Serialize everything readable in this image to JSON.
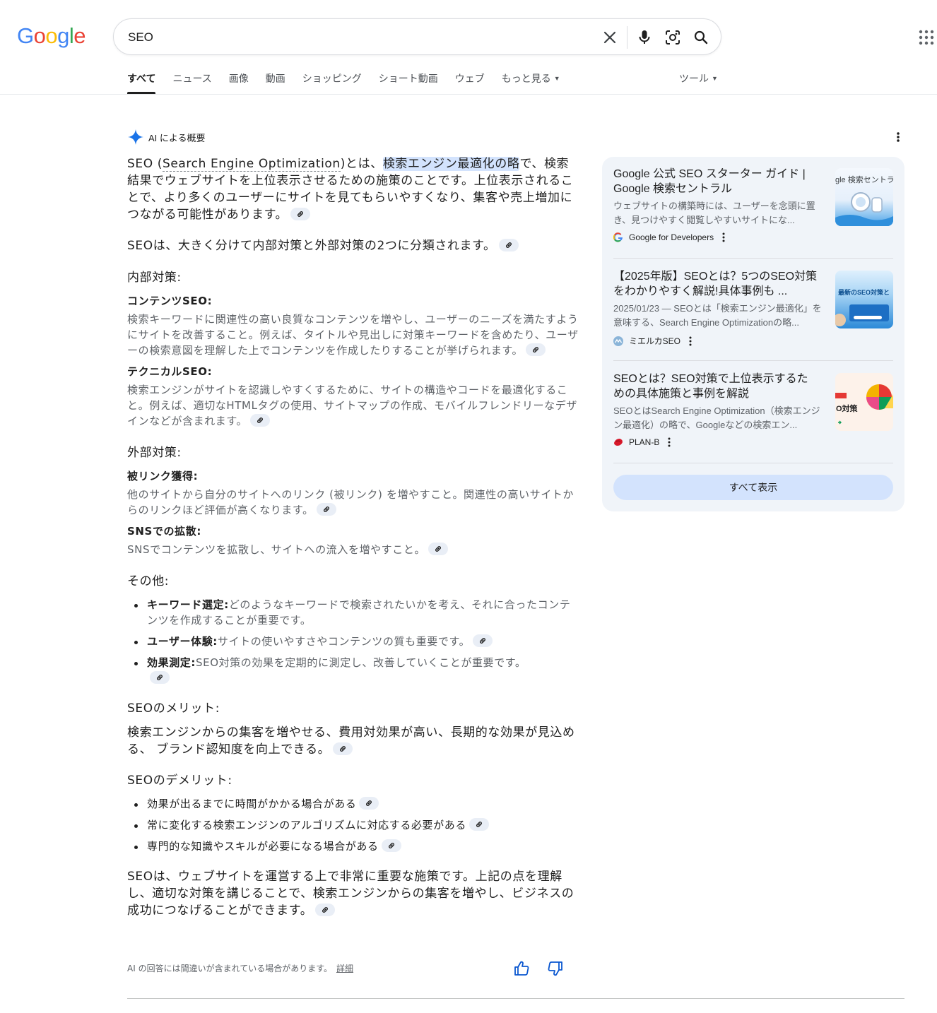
{
  "logo": {
    "letters": [
      "G",
      "o",
      "o",
      "g",
      "l",
      "e"
    ],
    "colors": [
      "#4285F4",
      "#EA4335",
      "#FBBC05",
      "#4285F4",
      "#34A853",
      "#EA4335"
    ]
  },
  "search": {
    "value": "SEO",
    "icons": [
      "close-icon",
      "mic-icon",
      "lens-icon",
      "search-icon"
    ]
  },
  "tabs": {
    "all": "すべて",
    "news": "ニュース",
    "images": "画像",
    "videos": "動画",
    "shopping": "ショッピング",
    "short_videos": "ショート動画",
    "web": "ウェブ",
    "more": "もっと見る",
    "tools": "ツール"
  },
  "ai_overview": {
    "header": "AI による概要",
    "intro_a": "SEO (",
    "intro_term": "Search Engine Optimization",
    "intro_b": ")とは、",
    "intro_hl": "検索エンジン最適化の略",
    "intro_c": "で、検索結果でウェブサイトを上位表示させるための施策のことです。上位表示されることで、より多くのユーザーにサイトを見てもらいやすくなり、集客や売上増加につながる可能性があります。",
    "classify": "SEOは、大きく分けて内部対策と外部対策の2つに分類されます。",
    "internal_heading": "内部対策:",
    "content_seo_heading": "コンテンツSEO:",
    "content_seo_text": "検索キーワードに関連性の高い良質なコンテンツを増やし、ユーザーのニーズを満たすようにサイトを改善すること。例えば、タイトルや見出しに対策キーワードを含めたり、ユーザーの検索意図を理解した上でコンテンツを作成したりすることが挙げられます。",
    "technical_seo_heading": "テクニカルSEO:",
    "technical_seo_text": "検索エンジンがサイトを認識しやすくするために、サイトの構造やコードを最適化すること。例えば、適切なHTMLタグの使用、サイトマップの作成、モバイルフレンドリーなデザインなどが含まれます。",
    "external_heading": "外部対策:",
    "backlink_heading": "被リンク獲得:",
    "backlink_text": "他のサイトから自分のサイトへのリンク (被リンク) を増やすこと。関連性の高いサイトからのリンクほど評価が高くなります。",
    "sns_heading": "SNSでの拡散:",
    "sns_text": "SNSでコンテンツを拡散し、サイトへの流入を増やすこと。",
    "other_heading": "その他:",
    "other_items": [
      {
        "bold": "キーワード選定:",
        "text": "どのようなキーワードで検索されたいかを考え、それに合ったコンテンツを作成することが重要です。"
      },
      {
        "bold": "ユーザー体験:",
        "text": "サイトの使いやすさやコンテンツの質も重要です。"
      },
      {
        "bold": "効果測定:",
        "text": "SEO対策の効果を定期的に測定し、改善していくことが重要です。"
      }
    ],
    "merit_heading": "SEOのメリット:",
    "merit_text": "検索エンジンからの集客を増やせる、費用対効果が高い、長期的な効果が見込める、 ブランド認知度を向上できる。",
    "demerit_heading": "SEOのデメリット:",
    "demerit_items": [
      "効果が出るまでに時間がかかる場合がある",
      "常に変化する検索エンジンのアルゴリズムに対応する必要がある",
      "専門的な知識やスキルが必要になる場合がある"
    ],
    "conclusion": "SEOは、ウェブサイトを運営する上で非常に重要な施策です。上記の点を理解し、適切な対策を講じることで、検索エンジンからの集客を増やし、ビジネスの成功につなげることができます。",
    "disclaimer": "AI の回答には間違いが含まれている場合があります。",
    "disclaimer_link": "詳細"
  },
  "sources": [
    {
      "title": "Google 公式 SEO スターター ガイド | Google 検索セントラル",
      "snippet": "ウェブサイトの構築時には、ユーザーを念頭に置き、見つけやすく閲覧しやすいサイトにな...",
      "site": "Google for Developers",
      "thumb_text": "gle 検索セントラ"
    },
    {
      "title": "【2025年版】SEOとは？5つのSEO対策をわかりやすく解説!具体事例も ...",
      "snippet": "2025/01/23 — SEOとは「検索エンジン最適化」を意味する、Search Engine Optimizationの略...",
      "site": "ミエルカSEO",
      "thumb_text": "最新のSEO対策と"
    },
    {
      "title": "SEOとは？SEO対策で上位表示するための具体施策と事例を解説",
      "snippet": "SEOとはSearch Engine Optimization（検索エンジン最適化）の略で、Googleなどの検索エン...",
      "site": "PLAN-B",
      "thumb_text": "O対策"
    }
  ],
  "show_all": "すべて表示",
  "colors": {
    "accent": "#0b57d0",
    "chip": "#e9eef6",
    "panel": "#f0f4f9",
    "highlight": "#d3e3fd"
  }
}
